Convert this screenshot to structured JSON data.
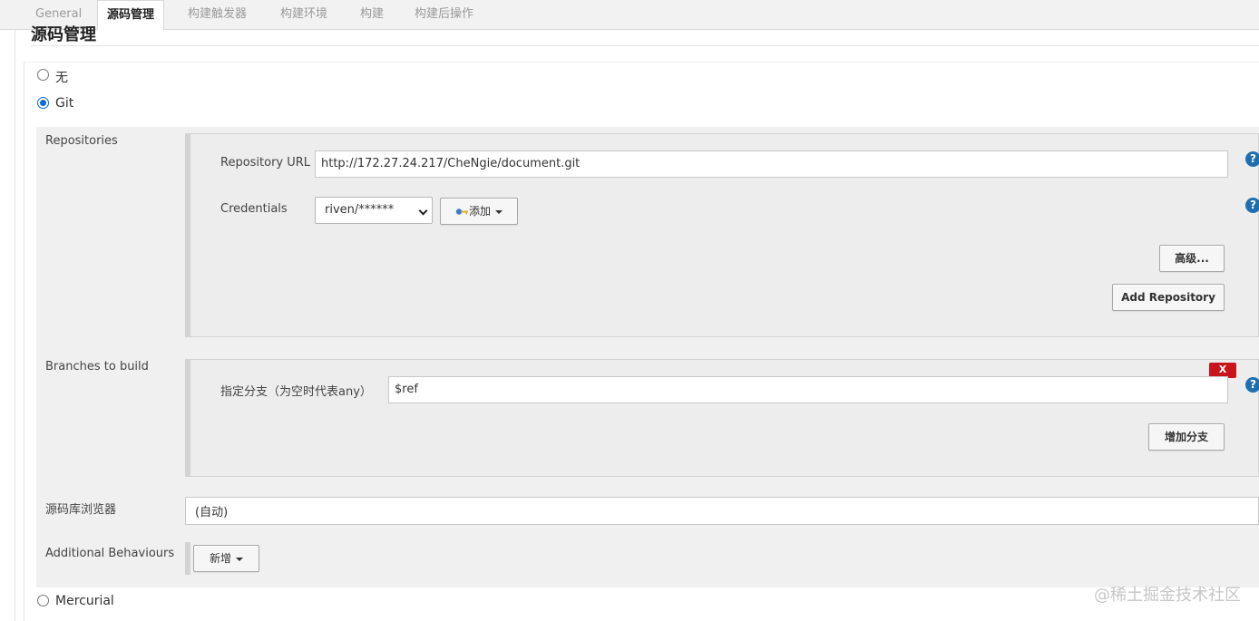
{
  "tabs": [
    {
      "label": "General"
    },
    {
      "label": "源码管理"
    },
    {
      "label": "构建触发器"
    },
    {
      "label": "构建环境"
    },
    {
      "label": "构建"
    },
    {
      "label": "构建后操作"
    }
  ],
  "section": {
    "title": "源码管理"
  },
  "scm_options": {
    "none": {
      "label": "无",
      "checked": false
    },
    "git": {
      "label": "Git",
      "checked": true
    },
    "mercurial": {
      "label": "Mercurial",
      "checked": false
    }
  },
  "repositories": {
    "label": "Repositories",
    "url_label": "Repository URL",
    "url_value": "http://172.27.24.217/CheNgie/document.git",
    "credentials_label": "Credentials",
    "credentials_value": "riven/******",
    "add_label": "添加",
    "advanced_label": "高级...",
    "add_repository_label": "Add Repository"
  },
  "branches": {
    "label": "Branches to build",
    "branch_label": "指定分支（为空时代表any）",
    "branch_value": "$ref",
    "delete_label": "X",
    "add_branch_label": "增加分支"
  },
  "browser": {
    "label": "源码库浏览器",
    "value": "(自动)"
  },
  "behaviours": {
    "label": "Additional Behaviours",
    "add_label": "新增"
  },
  "help": {
    "symbol": "?"
  },
  "watermark": "@稀土掘金技术社区",
  "colors": {
    "accent": "#0a6ad6",
    "help": "#1f6fb0",
    "danger": "#c9141c"
  }
}
